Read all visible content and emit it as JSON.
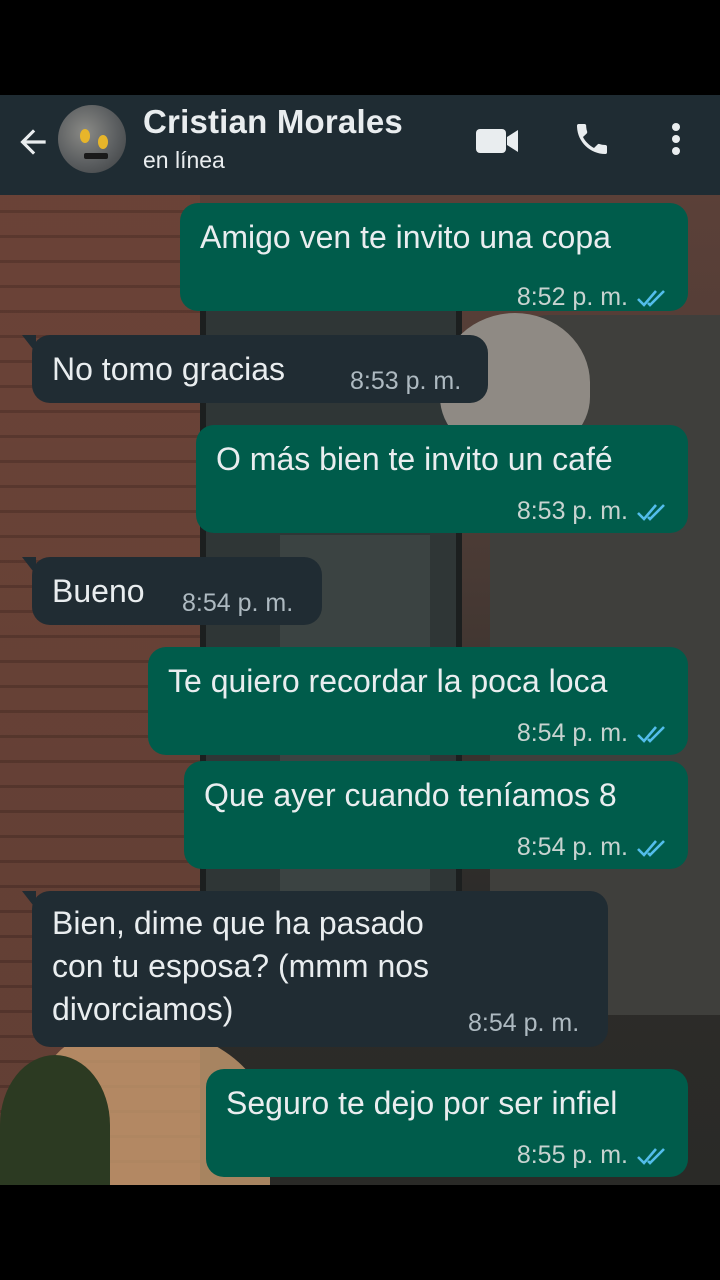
{
  "header": {
    "contact_name": "Cristian Morales",
    "status": "en línea",
    "icons": [
      "back-arrow-icon",
      "video-call-icon",
      "phone-call-icon",
      "more-options-icon"
    ]
  },
  "colors": {
    "header_bg": "#1f2c33",
    "outgoing_bubble": "#005c4b",
    "incoming_bubble": "#202c33",
    "read_ticks": "#53bdeb"
  },
  "messages": [
    {
      "direction": "out",
      "text": "Amigo ven te invito una copa",
      "time": "8:52 p. m.",
      "status": "read"
    },
    {
      "direction": "in",
      "text": "No tomo gracias",
      "time": "8:53 p. m."
    },
    {
      "direction": "out",
      "text": "O más bien te invito un café",
      "time": "8:53 p. m.",
      "status": "read"
    },
    {
      "direction": "in",
      "text": "Bueno",
      "time": "8:54 p. m."
    },
    {
      "direction": "out",
      "text": "Te quiero recordar la poca loca",
      "time": "8:54 p. m.",
      "status": "read"
    },
    {
      "direction": "out",
      "text": "Que ayer cuando teníamos 8",
      "time": "8:54 p. m.",
      "status": "read"
    },
    {
      "direction": "in",
      "lines": [
        "Bien, dime que ha pasado",
        "con tu esposa? (mmm nos",
        "divorciamos)"
      ],
      "time": "8:54 p. m."
    },
    {
      "direction": "out",
      "text": "Seguro te dejo por ser infiel",
      "time": "8:55 p. m.",
      "status": "read"
    }
  ]
}
